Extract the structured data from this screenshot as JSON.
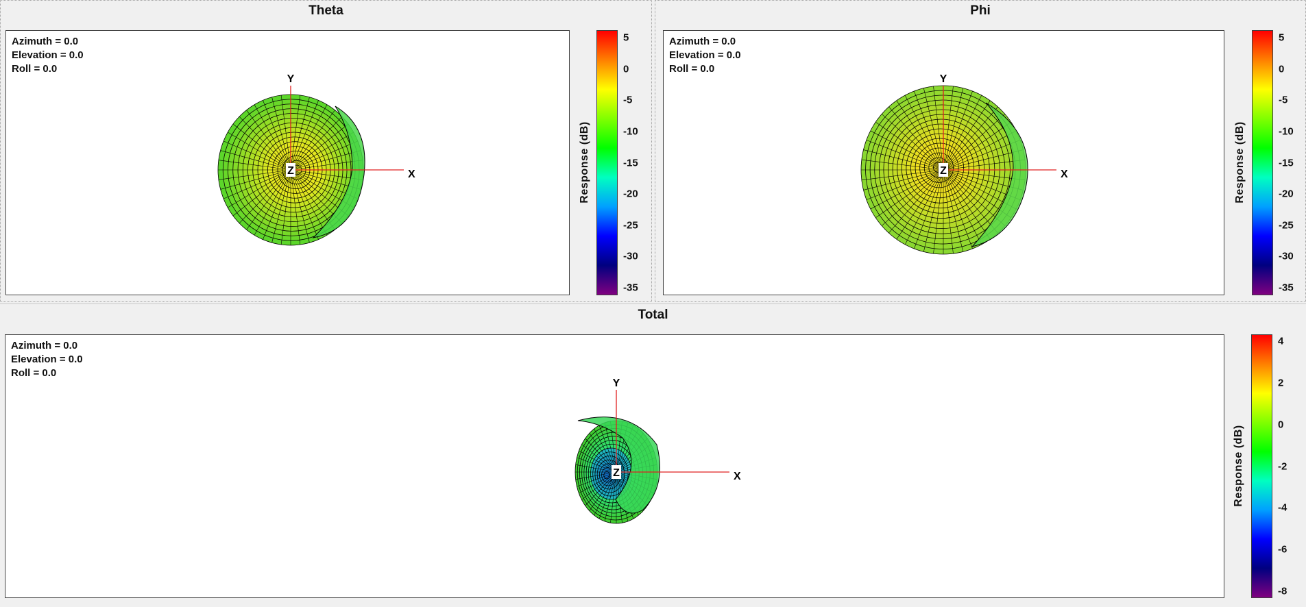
{
  "panels": {
    "theta": {
      "title": "Theta",
      "view": {
        "azimuth": "Azimuth = 0.0",
        "elevation": "Elevation = 0.0",
        "roll": "Roll = 0.0"
      },
      "axes": {
        "x": "X",
        "y": "Y",
        "z": "Z"
      },
      "colorbar": {
        "title": "Response  (dB)",
        "ticks": [
          "5",
          "0",
          "-5",
          "-10",
          "-15",
          "-20",
          "-25",
          "-30",
          "-35"
        ]
      }
    },
    "phi": {
      "title": "Phi",
      "view": {
        "azimuth": "Azimuth = 0.0",
        "elevation": "Elevation = 0.0",
        "roll": "Roll = 0.0"
      },
      "axes": {
        "x": "X",
        "y": "Y",
        "z": "Z"
      },
      "colorbar": {
        "title": "Response  (dB)",
        "ticks": [
          "5",
          "0",
          "-5",
          "-10",
          "-15",
          "-20",
          "-25",
          "-30",
          "-35"
        ]
      }
    },
    "total": {
      "title": "Total",
      "view": {
        "azimuth": "Azimuth = 0.0",
        "elevation": "Elevation = 0.0",
        "roll": "Roll = 0.0"
      },
      "axes": {
        "x": "X",
        "y": "Y",
        "z": "Z"
      },
      "colorbar": {
        "title": "Response  (dB)",
        "ticks": [
          "4",
          "2",
          "0",
          "-2",
          "-4",
          "-6",
          "-8"
        ]
      }
    }
  },
  "colors": {
    "axis_line": "#e02020",
    "mesh_line": "#000000",
    "colormap": [
      "#ff0000",
      "#ff8000",
      "#ffff00",
      "#80ff00",
      "#00ff00",
      "#00ffc0",
      "#00a0ff",
      "#0000ff",
      "#000080",
      "#800080"
    ]
  }
}
